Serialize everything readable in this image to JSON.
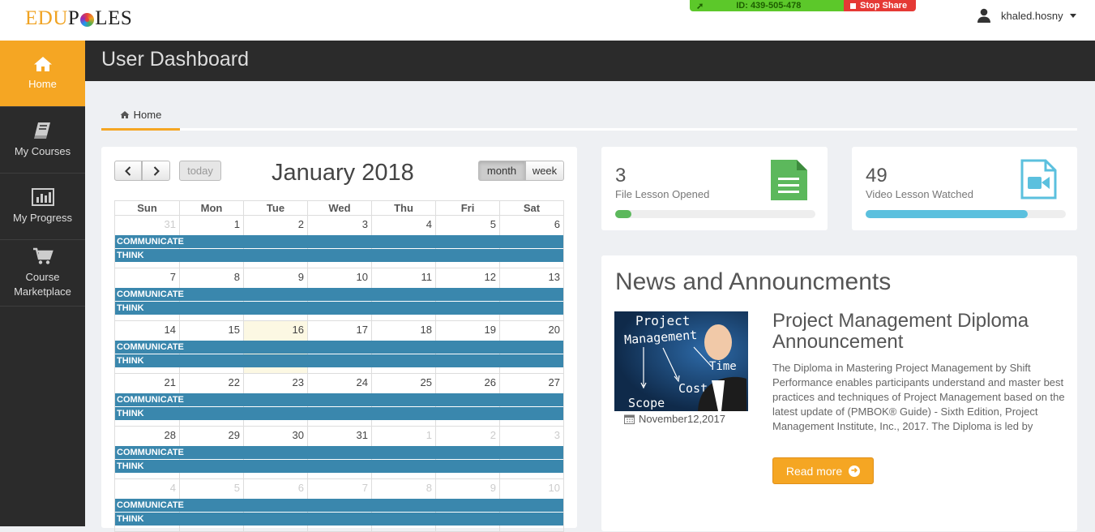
{
  "brand": {
    "edu": "EDU",
    "p": "P",
    "les": "LES"
  },
  "screen_share": {
    "id_label": "ID: 439-505-478",
    "stop_label": "Stop Share"
  },
  "user": {
    "name": "khaled.hosny"
  },
  "sidebar": {
    "items": [
      {
        "label": "Home",
        "icon": "home-icon",
        "active": true
      },
      {
        "label": "My Courses",
        "icon": "book-icon",
        "active": false
      },
      {
        "label": "My Progress",
        "icon": "bar-chart-icon",
        "active": false
      },
      {
        "label": "Course Marketplace",
        "icon": "cart-icon",
        "active": false
      }
    ]
  },
  "header": {
    "title": "User Dashboard"
  },
  "breadcrumb": {
    "home": "Home"
  },
  "calendar": {
    "title": "January 2018",
    "today_label": "today",
    "month_label": "month",
    "week_label": "week",
    "weekdays": [
      "Sun",
      "Mon",
      "Tue",
      "Wed",
      "Thu",
      "Fri",
      "Sat"
    ],
    "weeks": [
      [
        "31",
        "1",
        "2",
        "3",
        "4",
        "5",
        "6"
      ],
      [
        "7",
        "8",
        "9",
        "10",
        "11",
        "12",
        "13"
      ],
      [
        "14",
        "15",
        "16",
        "17",
        "18",
        "19",
        "20"
      ],
      [
        "21",
        "22",
        "23",
        "24",
        "25",
        "26",
        "27"
      ],
      [
        "28",
        "29",
        "30",
        "31",
        "1",
        "2",
        "3"
      ],
      [
        "4",
        "5",
        "6",
        "7",
        "8",
        "9",
        "10"
      ]
    ],
    "events": [
      "COMMUNICATE",
      "THINK"
    ]
  },
  "stats": {
    "files": {
      "count": "3",
      "label": "File Lesson Opened",
      "progress": 0.08,
      "color": "#5cb85c"
    },
    "videos": {
      "count": "49",
      "label": "Video Lesson Watched",
      "progress": 0.81,
      "color": "#5bc0de"
    }
  },
  "news": {
    "heading": "News and Announcments",
    "article": {
      "title": "Project Management Diploma Announcement",
      "date": "November12,2017",
      "body": "The Diploma in Mastering Project Management by Shift Performance enables participants understand and master best practices and techniques of Project Management based on the latest update of  (PMBOK® Guide) - Sixth Edition, Project Management Institute, Inc., 2017. The Diploma is led by",
      "read_more": "Read more",
      "image_words": [
        "Project",
        "Management",
        "Time",
        "Cost",
        "Scope"
      ]
    }
  }
}
